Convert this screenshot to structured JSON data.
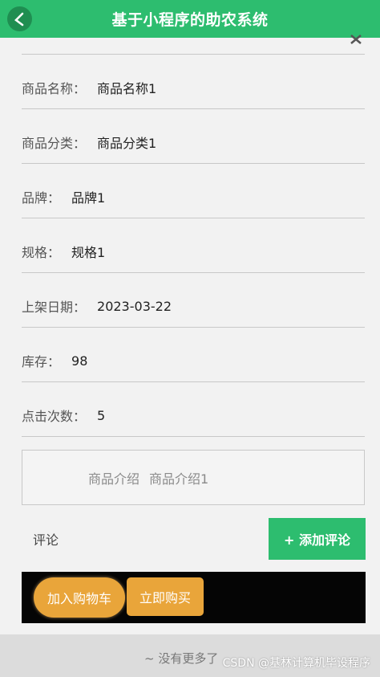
{
  "header": {
    "title": "基于小程序的助农系统"
  },
  "details": [
    {
      "label": "商品名称：",
      "value": "商品名称1"
    },
    {
      "label": "商品分类：",
      "value": "商品分类1"
    },
    {
      "label": "品牌：",
      "value": "品牌1"
    },
    {
      "label": "规格：",
      "value": "规格1"
    },
    {
      "label": "上架日期：",
      "value": "2023-03-22"
    },
    {
      "label": "库存：",
      "value": "98"
    },
    {
      "label": "点击次数：",
      "value": "5"
    }
  ],
  "description": {
    "label": "商品介绍",
    "value": "商品介绍1"
  },
  "comment": {
    "label": "评论",
    "add_button": "+ 添加评论"
  },
  "actions": {
    "add_to_cart": "加入购物车",
    "buy_now": "立即购买"
  },
  "footer": {
    "no_more": "~ 没有更多了",
    "watermark": "CSDN @基林计算机毕设程序"
  },
  "colors": {
    "primary": "#2dbd6f",
    "action": "#e9a53a"
  }
}
